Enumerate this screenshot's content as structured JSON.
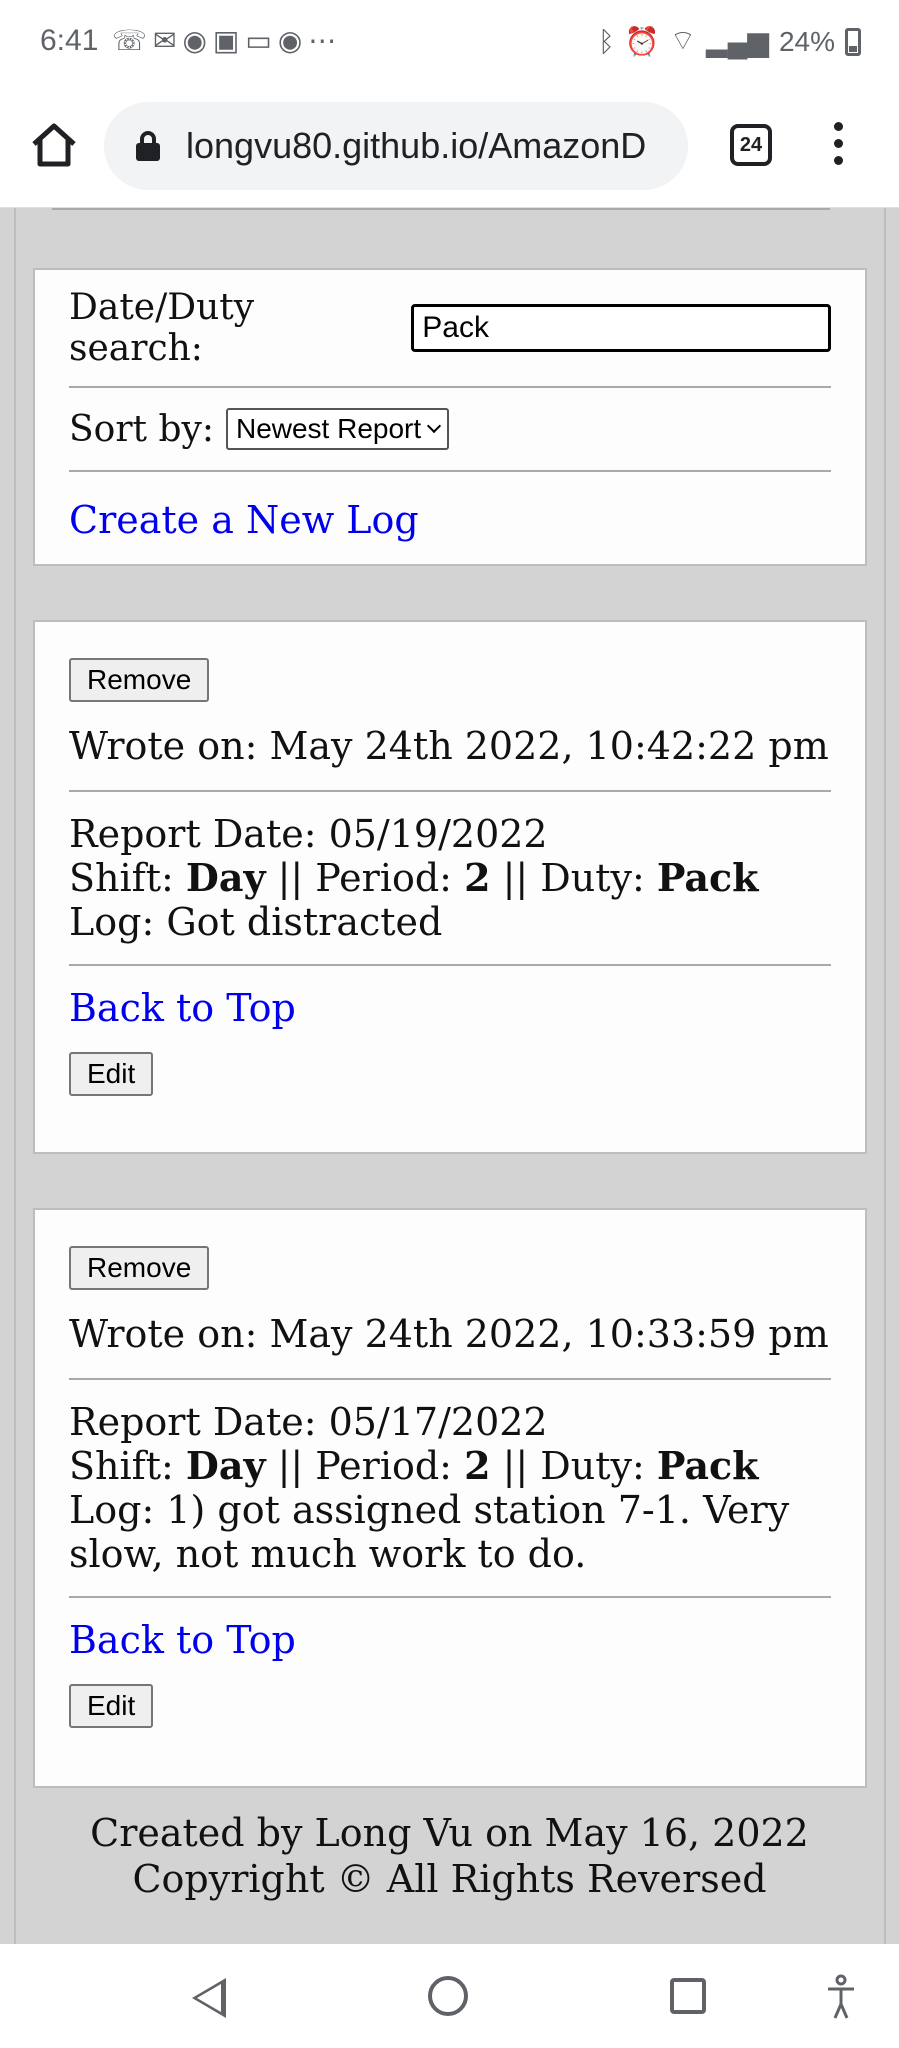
{
  "status_bar": {
    "time": "6:41",
    "notification_icons": [
      "missed-call-icon",
      "gmail-icon",
      "app-icon",
      "image-icon",
      "screen-icon",
      "app-icon",
      "more-icon"
    ],
    "battery_percent": "24%"
  },
  "browser": {
    "url": "longvu80.github.io/AmazonD",
    "tab_count": "24"
  },
  "search_panel": {
    "search_label": "Date/Duty search:",
    "search_value": "Pack",
    "sort_label": "Sort by:",
    "sort_selected": "Newest Report",
    "create_link": "Create a New Log"
  },
  "logs": [
    {
      "remove_label": "Remove",
      "wrote_on": "Wrote on: May 24th 2022, 10:42:22 pm",
      "report_date": "Report Date: 05/19/2022",
      "shift_label": "Shift: ",
      "shift": "Day",
      "period_label": " || Period: ",
      "period": "2",
      "duty_label": " || Duty: ",
      "duty": "Pack",
      "log": "Log: Got distracted",
      "back_to_top": "Back to Top",
      "edit_label": "Edit"
    },
    {
      "remove_label": "Remove",
      "wrote_on": "Wrote on: May 24th 2022, 10:33:59 pm",
      "report_date": "Report Date: 05/17/2022",
      "shift_label": "Shift: ",
      "shift": "Day",
      "period_label": " || Period: ",
      "period": "2",
      "duty_label": " || Duty: ",
      "duty": "Pack",
      "log": "Log: 1) got assigned station 7-1. Very slow, not much work to do.",
      "back_to_top": "Back to Top",
      "edit_label": "Edit"
    }
  ],
  "footer": {
    "line1": "Created by Long Vu on May 16, 2022",
    "line2": "Copyright © All Rights Reversed"
  }
}
